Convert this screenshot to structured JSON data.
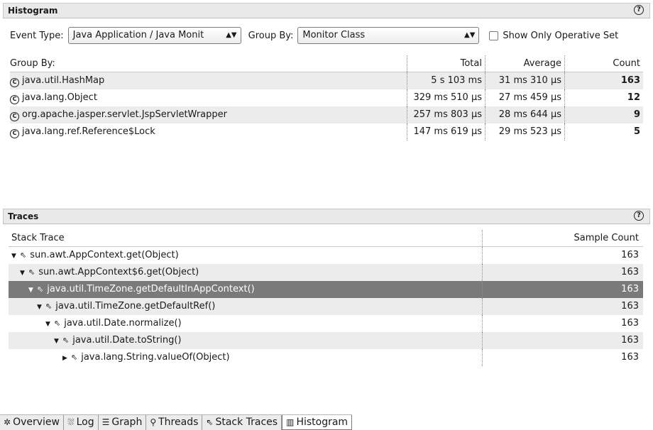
{
  "histogram": {
    "title": "Histogram",
    "help": "?",
    "event_type_label": "Event Type:",
    "event_type_value": "Java Application / Java Monit",
    "group_by_label": "Group By:",
    "group_by_value": "Monitor Class",
    "operative_label": "Show Only Operative Set",
    "operative_checked": false,
    "columns": [
      "Group By:",
      "Total",
      "Average",
      "Count"
    ],
    "rows": [
      {
        "name": "java.util.HashMap",
        "total": "5 s 103 ms",
        "average": "31 ms 310 µs",
        "count": "163"
      },
      {
        "name": "java.lang.Object",
        "total": "329 ms 510 µs",
        "average": "27 ms 459 µs",
        "count": "12"
      },
      {
        "name": "org.apache.jasper.servlet.JspServletWrapper",
        "total": "257 ms 803 µs",
        "average": "28 ms 644 µs",
        "count": "9"
      },
      {
        "name": "java.lang.ref.Reference$Lock",
        "total": "147 ms 619 µs",
        "average": "29 ms 523 µs",
        "count": "5"
      }
    ]
  },
  "traces": {
    "title": "Traces",
    "help": "?",
    "columns": [
      "Stack Trace",
      "Sample Count"
    ],
    "rows": [
      {
        "frame": "sun.awt.AppContext.get(Object)",
        "count": "163",
        "toggle": "▼"
      },
      {
        "frame": "sun.awt.AppContext$6.get(Object)",
        "count": "163",
        "toggle": "▼"
      },
      {
        "frame": "java.util.TimeZone.getDefaultInAppContext()",
        "count": "163",
        "toggle": "▼"
      },
      {
        "frame": "java.util.TimeZone.getDefaultRef()",
        "count": "163",
        "toggle": "▼"
      },
      {
        "frame": "java.util.Date.normalize()",
        "count": "163",
        "toggle": "▼"
      },
      {
        "frame": "java.util.Date.toString()",
        "count": "163",
        "toggle": "▼"
      },
      {
        "frame": "java.lang.String.valueOf(Object)",
        "count": "163",
        "toggle": "▶"
      }
    ]
  },
  "tabs": [
    {
      "label": "Overview",
      "icon": "✲"
    },
    {
      "label": "Log",
      "icon": "⛆"
    },
    {
      "label": "Graph",
      "icon": "☰"
    },
    {
      "label": "Threads",
      "icon": "⚲"
    },
    {
      "label": "Stack Traces",
      "icon": "⇖"
    },
    {
      "label": "Histogram",
      "icon": "▥"
    }
  ],
  "active_tab": "Histogram"
}
